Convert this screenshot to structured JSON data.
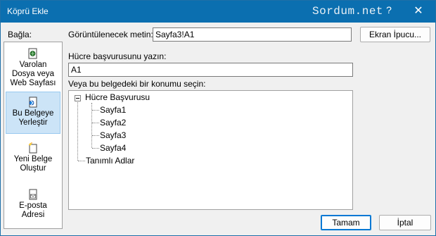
{
  "window": {
    "title": "Köprü Ekle",
    "watermark": "Sordum.net",
    "help_glyph": "?",
    "close_glyph": "✕"
  },
  "link_to_label": "Bağla:",
  "sidebar": {
    "items": [
      {
        "lines": [
          "Varolan",
          "Dosya veya",
          "Web Sayfası"
        ],
        "icon": "existing-file-icon",
        "selected": false
      },
      {
        "lines": [
          "Bu Belgeye",
          "Yerleştir"
        ],
        "icon": "place-in-document-icon",
        "selected": true
      },
      {
        "lines": [
          "Yeni Belge",
          "Oluştur"
        ],
        "icon": "new-document-icon",
        "selected": false
      },
      {
        "lines": [
          "E-posta",
          "Adresi"
        ],
        "icon": "email-icon",
        "selected": false
      }
    ]
  },
  "display_text": {
    "label": "Görüntülenecek metin:",
    "value": "Sayfa3!A1"
  },
  "screentip_button": "Ekran İpucu...",
  "cell_ref": {
    "label": "Hücre başvurusunu yazın:",
    "value": "A1"
  },
  "place_label": "Veya bu belgedeki bir konumu seçin:",
  "tree": {
    "root": "Hücre Başvurusu",
    "sheets": [
      "Sayfa1",
      "Sayfa2",
      "Sayfa3",
      "Sayfa4"
    ],
    "defined_names": "Tanımlı Adlar"
  },
  "buttons": {
    "ok": "Tamam",
    "cancel": "İptal"
  }
}
